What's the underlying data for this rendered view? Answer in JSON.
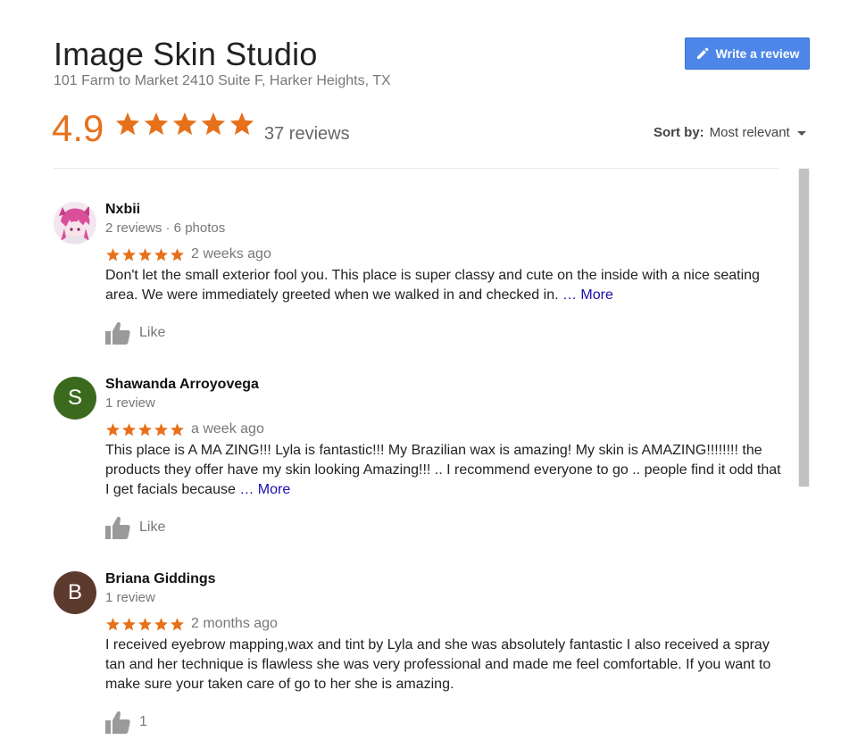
{
  "header": {
    "title": "Image Skin Studio",
    "address": "101 Farm to Market 2410 Suite F, Harker Heights, TX",
    "write_review_label": "Write a review"
  },
  "summary": {
    "rating": "4.9",
    "stars": 5,
    "review_count": "37 reviews"
  },
  "sort": {
    "label": "Sort by:",
    "value": "Most relevant"
  },
  "colors": {
    "star": "#e7711b",
    "button": "#4d86e8",
    "link": "#1a0dab"
  },
  "reviews": [
    {
      "name": "Nxbii",
      "meta": "2 reviews · 6 photos",
      "stars": 5,
      "when": "2 weeks ago",
      "text": "Don't let the small exterior fool you. This place is super classy and cute on the inside with a nice seating area. We were immediately greeted when we walked in and checked in. ",
      "more": "… More",
      "like_label": "Like",
      "avatar_icon": "anime-character-avatar-icon"
    },
    {
      "name": "Shawanda Arroyovega",
      "meta": "1 review",
      "stars": 5,
      "when": "a week ago",
      "text": "This place is A MA ZING!!! Lyla is fantastic!!! My Brazilian wax is amazing! My skin is AMAZING!!!!!!!! the products they offer have my skin looking Amazing!!! .. I recommend everyone to go .. people find it odd that I get facials because ",
      "more": "… More",
      "like_label": "Like",
      "avatar_letter": "S",
      "avatar_color": "#3b6a1f"
    },
    {
      "name": "Briana Giddings",
      "meta": "1 review",
      "stars": 5,
      "when": "2 months ago",
      "text": "I received eyebrow mapping,wax and tint by Lyla and she was absolutely fantastic I also received a spray tan and her technique is flawless she was very professional and made me feel comfortable. If you want to make sure your taken care of go to her she is amazing.",
      "like_label": "1",
      "avatar_letter": "B",
      "avatar_color": "#5d3a2e"
    }
  ]
}
